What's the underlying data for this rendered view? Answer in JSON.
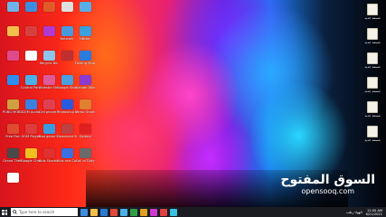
{
  "desktop": {
    "icons": [
      {
        "label": "",
        "icon": "recycle-icon",
        "color": "#6fb4e8"
      },
      {
        "label": "",
        "icon": "chrome-icon",
        "color": "#3c8de0"
      },
      {
        "label": "",
        "icon": "app-icon",
        "color": "#e05a2a"
      },
      {
        "label": "",
        "icon": "app-icon",
        "color": "#e0e0e0"
      },
      {
        "label": "",
        "icon": "this-pc-icon",
        "color": "#5aaee8"
      },
      {
        "label": "",
        "icon": "folder-icon",
        "color": "#f2c04a"
      },
      {
        "label": "",
        "icon": "app-icon",
        "color": "#d84040"
      },
      {
        "label": "",
        "icon": "app-icon",
        "color": "#b03ad0"
      },
      {
        "label": "Network",
        "icon": "network-icon",
        "color": "#4a9ae0"
      },
      {
        "label": "NBtter",
        "icon": "app-icon",
        "color": "#3aa0e0"
      },
      {
        "label": "",
        "icon": "app-icon",
        "color": "#e04a8a"
      },
      {
        "label": "",
        "icon": "app-icon",
        "color": "#ffffff"
      },
      {
        "label": "Recycle Bin",
        "icon": "recycle-icon",
        "color": "#8fc4ea"
      },
      {
        "label": "",
        "icon": "app-icon",
        "color": "#c03030"
      },
      {
        "label": "Folding Music",
        "icon": "app-icon",
        "color": "#2a7ae0"
      },
      {
        "label": "",
        "icon": "app-icon",
        "color": "#2c8ef0"
      },
      {
        "label": "Control Panel",
        "icon": "control-panel-icon",
        "color": "#4ab0e8"
      },
      {
        "label": "Celestia Shortcut",
        "icon": "app-icon",
        "color": "#e05a9a"
      },
      {
        "label": "Google Shortcut",
        "icon": "app-icon",
        "color": "#4aa0e0"
      },
      {
        "label": "Slander Nitro",
        "icon": "app-icon",
        "color": "#8a3ad0"
      },
      {
        "label": "PUBG MOBILE",
        "icon": "app-icon",
        "color": "#d0a040"
      },
      {
        "label": "GOM Audio",
        "icon": "app-icon",
        "color": "#3a80e0"
      },
      {
        "label": "Cell phone Shortcut",
        "icon": "app-icon",
        "color": "#e04050"
      },
      {
        "label": "Photoshop Shortcut",
        "icon": "app-icon",
        "color": "#2a5ae0"
      },
      {
        "label": "Vertor Shortcut",
        "icon": "app-icon",
        "color": "#e08030"
      },
      {
        "label": "Free Fire",
        "icon": "app-icon",
        "color": "#e04a30"
      },
      {
        "label": "GOM Player",
        "icon": "app-icon",
        "color": "#e03a3a"
      },
      {
        "label": "Bad game Shortcut",
        "icon": "app-icon",
        "color": "#3a9ae0"
      },
      {
        "label": "Download Shortcut",
        "icon": "app-icon",
        "color": "#c04040"
      },
      {
        "label": "Garena",
        "icon": "app-icon",
        "color": "#e02020"
      },
      {
        "label": "Grand Theft",
        "icon": "app-icon",
        "color": "#4a4a4a"
      },
      {
        "label": "Google Chrome",
        "icon": "chrome-icon",
        "color": "#f0c020"
      },
      {
        "label": "Kids Shortcut",
        "icon": "app-icon",
        "color": "#e03030"
      },
      {
        "label": "Kids and Complete",
        "icon": "app-icon",
        "color": "#3a70e0"
      },
      {
        "label": "Call of Duty",
        "icon": "app-icon",
        "color": "#6a6a6a"
      },
      {
        "label": "",
        "icon": "app-icon",
        "color": "#ffffff"
      }
    ],
    "right_icons": [
      {
        "label": "مستند جديد",
        "icon": "document-icon"
      },
      {
        "label": "مستند جديد",
        "icon": "document-icon"
      },
      {
        "label": "مستند جديد",
        "icon": "document-icon"
      },
      {
        "label": "مستند جديد",
        "icon": "document-icon"
      },
      {
        "label": "مستند جديد",
        "icon": "document-icon"
      },
      {
        "label": "مستند جديد",
        "icon": "document-icon"
      }
    ],
    "watermark": {
      "arabic": "السوق المفتوح",
      "latin": "opensooq.com"
    }
  },
  "taskbar": {
    "search_placeholder": "Type here to search",
    "apps": [
      "#3a8ee0",
      "#f2c04a",
      "#2a7ad0",
      "#e04a3a",
      "#4ab0e8",
      "#2fa04a",
      "#e0a020",
      "#d03ad0",
      "#e04040",
      "#3ac0e0"
    ],
    "tray_text": "الهواء رطب",
    "time": "12:00 AM",
    "date": "6/21/2021"
  }
}
